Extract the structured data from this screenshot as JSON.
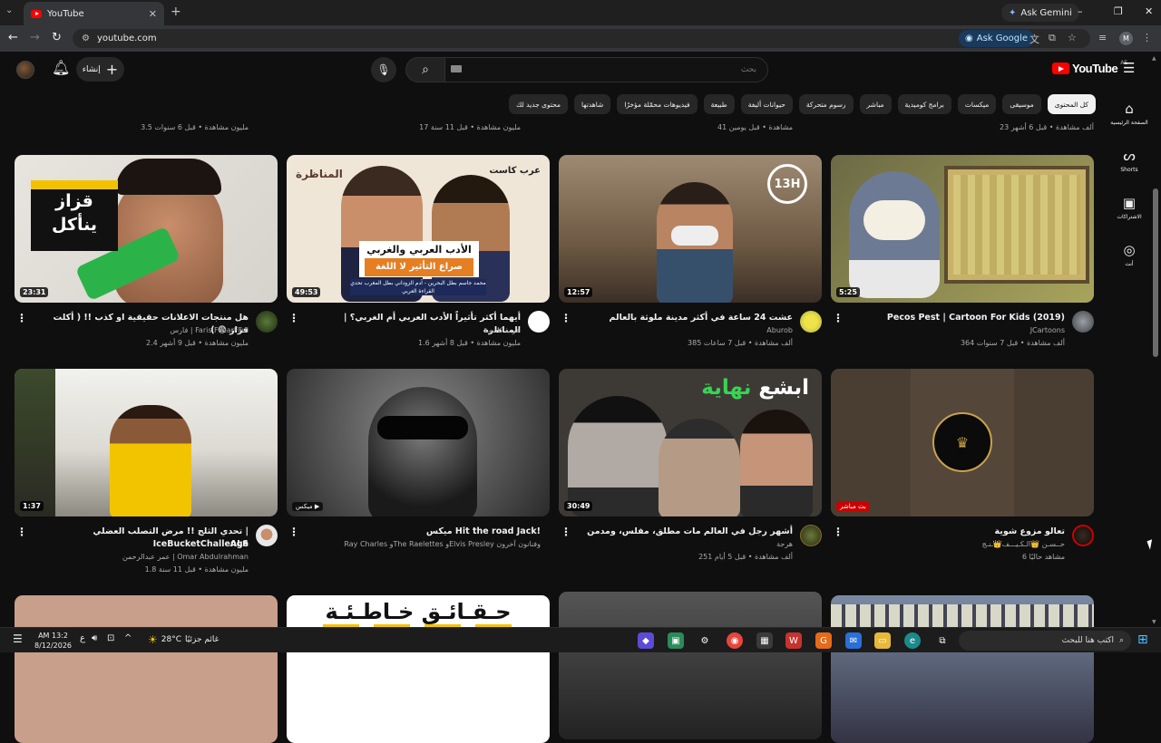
{
  "browser": {
    "tab_title": "YouTube",
    "gemini_label": "Ask Gemini",
    "url": "youtube.com",
    "ask_google_label": "Ask Google",
    "profile_initial": "M"
  },
  "header": {
    "create_label": "إنشاء",
    "search_placeholder": "بحث",
    "logo_word": "YouTube",
    "logo_country": "AE"
  },
  "chips": [
    {
      "label": "كل المحتوى",
      "active": true
    },
    {
      "label": "موسيقى"
    },
    {
      "label": "ميكسات"
    },
    {
      "label": "برامج كوميدية"
    },
    {
      "label": "مباشر"
    },
    {
      "label": "رسوم متحركة"
    },
    {
      "label": "حيوانات أليفة"
    },
    {
      "label": "طبيعة"
    },
    {
      "label": "فيديوهات محمّلة مؤخرًا"
    },
    {
      "label": "شاهدتها"
    },
    {
      "label": "محتوى جديد لك"
    }
  ],
  "guide": [
    {
      "label": "الصفحة الرئيسية",
      "icon": "home-icon"
    },
    {
      "label": "Shorts",
      "icon": "shorts-icon"
    },
    {
      "label": "الاشتراكات",
      "icon": "subscriptions-icon"
    },
    {
      "label": "أنت",
      "icon": "you-icon"
    }
  ],
  "top_row_meta": [
    "23 ألف مشاهدة • قبل 6 أشهر",
    "41 مشاهدة • قبل يومين",
    "17 مليون مشاهدة • قبل 11 سنة",
    "3.5 مليون مشاهدة • قبل 6 سنوات"
  ],
  "videos": [
    {
      "title": "Pecos Pest | Cartoon For Kids (2019)",
      "channel": "JCartoons",
      "meta": "364 ألف مشاهدة • قبل 7 سنوات",
      "duration": "5:25"
    },
    {
      "title": "عشت 24 ساعة في أكثر مدينة ملوثة بالعالم",
      "channel": "Aburob",
      "meta": "385 ألف مشاهدة • قبل 7 ساعات",
      "duration": "12:57"
    },
    {
      "title": "أيهما أكثر تأثيراً الأدب العربي أم الغربي؟ | المناظرة",
      "channel": "عرب كاست",
      "meta": "1.6 مليون مشاهدة • قبل 8 أشهر",
      "duration": "49:53"
    },
    {
      "title": "هل منتجات الاعلانات حقيقية او كذب !! ( أكلت قزاز 😨 )",
      "channel": "فارس | Faris FFearFFul",
      "meta": "2.4 مليون مشاهدة • قبل 9 أشهر",
      "duration": "23:31"
    },
    {
      "title": "تعالو مزوع شوية",
      "channel": "حــسـن 👑الـكـيـــف👑ـنـج",
      "meta": "6 مشاهد حاليًا",
      "live": "بث مباشر",
      "avatar_badge": "بث مباشر"
    },
    {
      "title": "أشهر رجل في العالم مات مطلق، مفلس، ومدمن",
      "channel": "هرجة",
      "meta": "251 ألف مشاهدة • قبل 5 أيام",
      "duration": "30:49"
    },
    {
      "title": "ميكس Hit the road Jack!",
      "channel": "Ray Charles وThe Raelettes وElvis Presley وفنانون آخرون",
      "meta": "",
      "badge": "ميكس"
    },
    {
      "title_line1": "تحدي الثلج !! مرض التصلب العضلي | IceBucketChallenge",
      "title_line2": "ALS",
      "channel": "عمر عبدالرحمن | Omar Abdulrahman",
      "meta": "1.8 مليون مشاهدة • قبل 11 سنة",
      "duration": "1:37"
    }
  ],
  "thumbs_text": {
    "t1_board": "قزاز ينأكل",
    "t2_head": "الأدب العربي والغربي",
    "t2_sub": "صراع التأثير لا اللغة",
    "t2_lower": "محمد جاسم بطل البحرين - آدم الزوداني بطل المغرب تحدي القراءة العربي",
    "t2_left": "المناظرة",
    "t2_right": "عرب كاست",
    "t3_clock": "13H",
    "t7_title_w": "ابشع",
    "t7_title_g": "نهاية",
    "t10_text": "حـقـائـق خـاطـئـة"
  },
  "taskbar": {
    "search_placeholder": "اكتب هنا للبحث",
    "weather_temp": "28°C",
    "weather_desc": "غائم جزئيًا",
    "time": "AM 13:2",
    "date": "8/12/2026",
    "lang": "ع"
  },
  "colors": {
    "yt_red": "#ff0000",
    "bg": "#0f0f0f",
    "chip": "#272727"
  }
}
